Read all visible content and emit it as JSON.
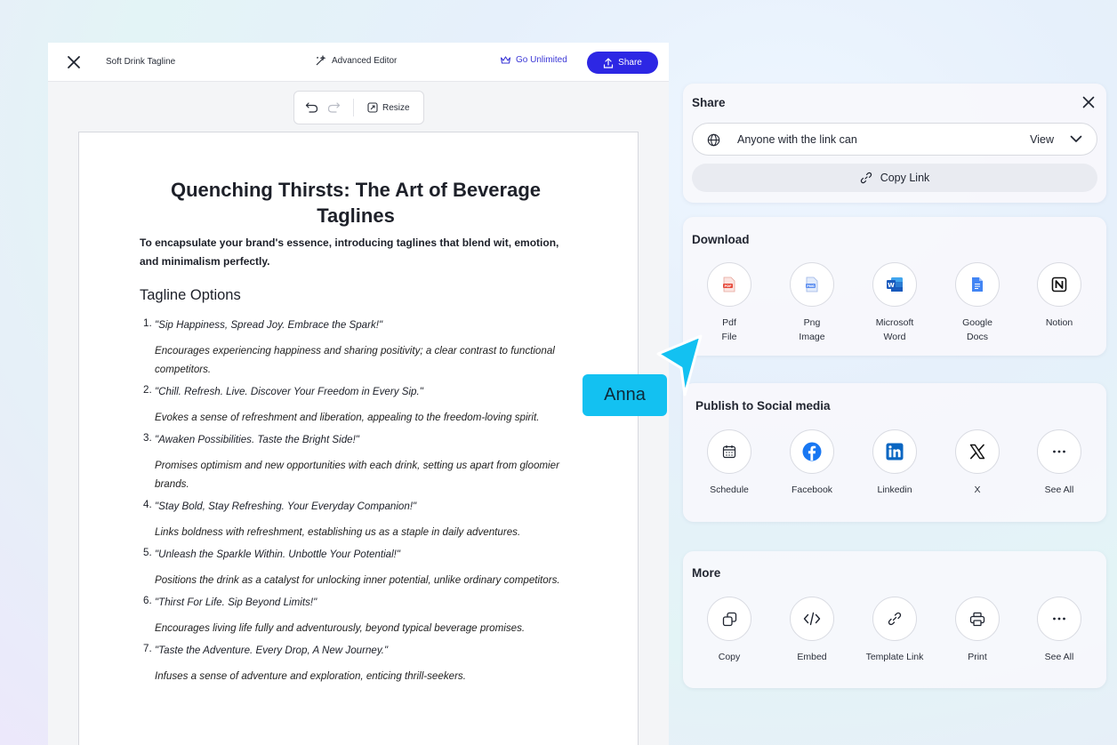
{
  "editor": {
    "doc_title": "Soft Drink Tagline",
    "advanced_editor": "Advanced Editor",
    "go_unlimited": "Go Unlimited",
    "share": "Share",
    "resize": "Resize"
  },
  "document": {
    "title": "Quenching Thirsts: The Art of Beverage Taglines",
    "intro": "To encapsulate your brand's essence, introducing taglines that blend wit, emotion, and minimalism perfectly.",
    "section_heading": "Tagline Options",
    "options": [
      {
        "num": "1.",
        "tagline": "\"Sip Happiness, Spread Joy. Embrace the Spark!\"",
        "desc": "Encourages experiencing happiness and sharing positivity; a clear contrast to functional competitors."
      },
      {
        "num": "2.",
        "tagline": "\"Chill. Refresh. Live. Discover Your Freedom in Every Sip.\"",
        "desc": "Evokes a sense of refreshment and liberation, appealing to the freedom-loving spirit."
      },
      {
        "num": "3.",
        "tagline": "\"Awaken Possibilities. Taste the Bright Side!\"",
        "desc": "Promises optimism and new opportunities with each drink, setting us apart from gloomier brands."
      },
      {
        "num": "4.",
        "tagline": "\"Stay Bold, Stay Refreshing. Your Everyday Companion!\"",
        "desc": "Links boldness with refreshment, establishing us as a staple in daily adventures."
      },
      {
        "num": "5.",
        "tagline": "\"Unleash the Sparkle Within. Unbottle Your Potential!\"",
        "desc": "Positions the drink as a catalyst for unlocking inner potential, unlike ordinary competitors."
      },
      {
        "num": "6.",
        "tagline": "\"Thirst For Life. Sip Beyond Limits!\"",
        "desc": "Encourages living life fully and adventurously, beyond typical beverage promises."
      },
      {
        "num": "7.",
        "tagline": "\"Taste the Adventure. Every Drop, A New Journey.\"",
        "desc": "Infuses a sense of adventure and exploration, enticing thrill-seekers."
      }
    ]
  },
  "share_panel": {
    "title": "Share",
    "permission_text": "Anyone with the link can",
    "permission_value": "View",
    "copy_link": "Copy Link"
  },
  "download_panel": {
    "title": "Download",
    "items": [
      {
        "label": "Pdf\nFile",
        "icon": "pdf-file-icon"
      },
      {
        "label": "Png\nImage",
        "icon": "png-image-icon"
      },
      {
        "label": "Microsoft\nWord",
        "icon": "microsoft-word-icon"
      },
      {
        "label": "Google\nDocs",
        "icon": "google-docs-icon"
      },
      {
        "label": "Notion",
        "icon": "notion-icon"
      }
    ]
  },
  "social_panel": {
    "title": "Publish to Social media",
    "items": [
      {
        "label": "Schedule",
        "icon": "calendar-icon"
      },
      {
        "label": "Facebook",
        "icon": "facebook-icon"
      },
      {
        "label": "Linkedin",
        "icon": "linkedin-icon"
      },
      {
        "label": "X",
        "icon": "x-icon"
      },
      {
        "label": "See All",
        "icon": "more-icon"
      }
    ]
  },
  "more_panel": {
    "title": "More",
    "items": [
      {
        "label": "Copy",
        "icon": "copy-icon"
      },
      {
        "label": "Embed",
        "icon": "code-icon"
      },
      {
        "label": "Template Link",
        "icon": "link-icon"
      },
      {
        "label": "Print",
        "icon": "printer-icon"
      },
      {
        "label": "See All",
        "icon": "more-icon"
      }
    ]
  },
  "cursor": {
    "user_name": "Anna"
  },
  "colors": {
    "primary": "#2d27e4",
    "cursor_accent": "#13c1f1",
    "facebook": "#1877f2",
    "linkedin": "#0a66c2",
    "word": "#185abd",
    "docs": "#4285f4",
    "pdf": "#e64a3b"
  }
}
